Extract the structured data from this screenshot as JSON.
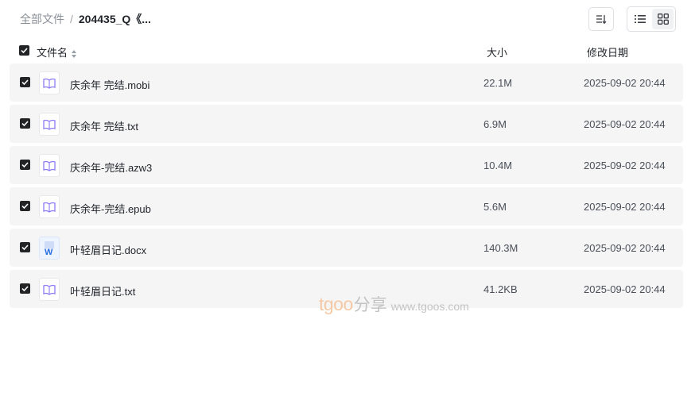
{
  "breadcrumb": {
    "root": "全部文件",
    "separator": "/",
    "current": "204435_Q《..."
  },
  "toolbar": {
    "sort_icon": "sort-icon",
    "list_view_icon": "list-view-icon",
    "grid_view_icon": "grid-view-icon",
    "active_view": "list"
  },
  "columns": {
    "name": "文件名",
    "size": "大小",
    "date": "修改日期"
  },
  "files": [
    {
      "name": "庆余年 完结.mobi",
      "size": "22.1M",
      "date": "2025-09-02 20:44",
      "icon": "ebook-icon",
      "checked": true
    },
    {
      "name": "庆余年 完结.txt",
      "size": "6.9M",
      "date": "2025-09-02 20:44",
      "icon": "ebook-icon",
      "checked": true
    },
    {
      "name": "庆余年-完结.azw3",
      "size": "10.4M",
      "date": "2025-09-02 20:44",
      "icon": "ebook-icon",
      "checked": true
    },
    {
      "name": "庆余年-完结.epub",
      "size": "5.6M",
      "date": "2025-09-02 20:44",
      "icon": "ebook-icon",
      "checked": true
    },
    {
      "name": "叶轻眉日记.docx",
      "size": "140.3M",
      "date": "2025-09-02 20:44",
      "icon": "word-doc-icon",
      "checked": true
    },
    {
      "name": "叶轻眉日记.txt",
      "size": "41.2KB",
      "date": "2025-09-02 20:44",
      "icon": "ebook-icon",
      "checked": true
    }
  ],
  "watermark": {
    "brand": "tgoo",
    "share": "分享",
    "url": "www.tgoos.com"
  },
  "colors": {
    "row_background": "#f5f5f6",
    "checkbox": "#222426",
    "ebook_icon": "#8b7cf6",
    "word_icon": "#2b6fe0"
  }
}
